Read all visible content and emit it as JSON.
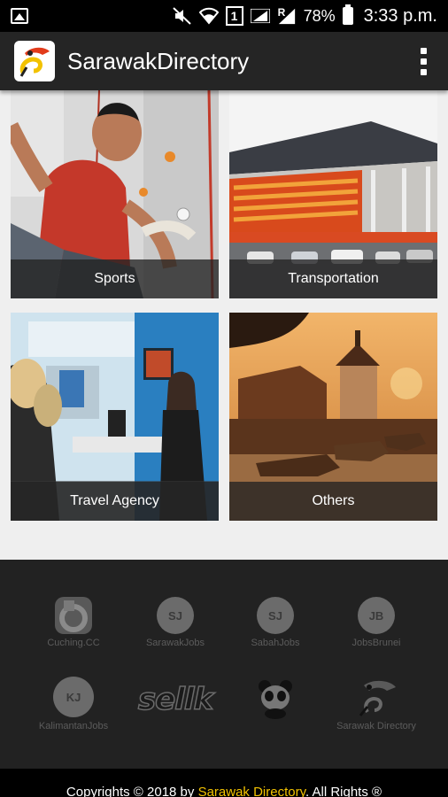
{
  "status_bar": {
    "battery_percent": "78%",
    "time": "3:33 p.m.",
    "sim_label": "1",
    "roaming_label": "R"
  },
  "app_bar": {
    "title": "SarawakDirectory"
  },
  "categories": [
    {
      "label": "Sports"
    },
    {
      "label": "Transportation"
    },
    {
      "label": "Travel Agency"
    },
    {
      "label": "Others"
    }
  ],
  "partners": [
    {
      "name": "Cuching.CC"
    },
    {
      "name": "SarawakJobs",
      "badge": "SJ"
    },
    {
      "name": "SabahJobs",
      "badge": "SJ"
    },
    {
      "name": "JobsBrunei",
      "badge": "JB"
    },
    {
      "name": "KalimantanJobs",
      "badge": "KJ"
    },
    {
      "name": "sellk"
    },
    {
      "name": ""
    },
    {
      "name": "Sarawak Directory"
    }
  ],
  "footer": {
    "copyright_prefix": "Copyrights © 2018 by ",
    "brand": "Sarawak Directory",
    "copyright_suffix": ". All Rights ®"
  },
  "colors": {
    "brand_yellow": "#f2c200",
    "app_bar": "#252525",
    "footer_bg": "#222222"
  }
}
